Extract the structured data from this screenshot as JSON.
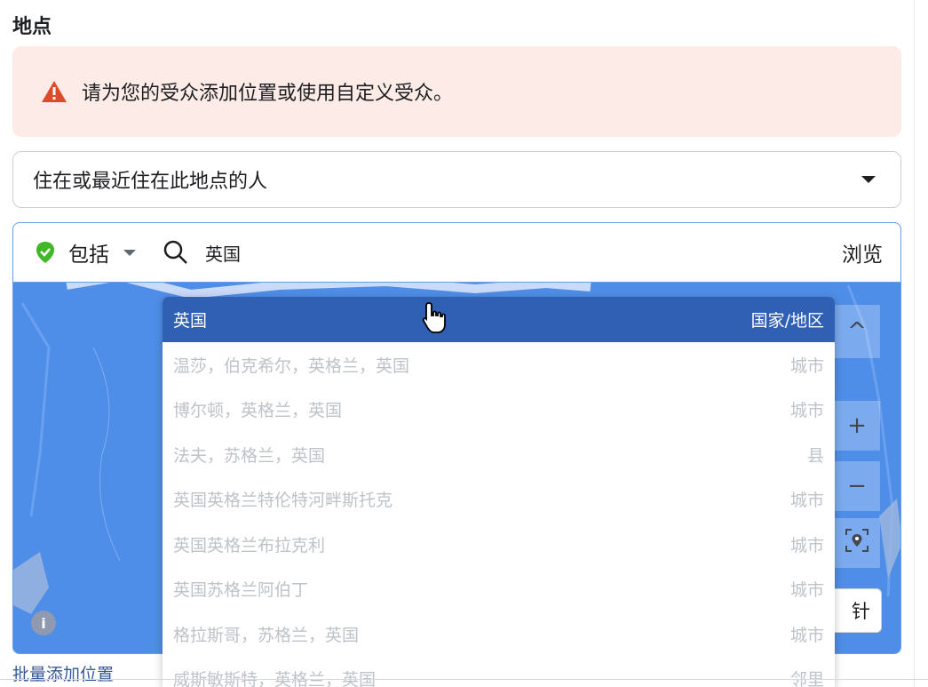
{
  "section_title": "地点",
  "warning": {
    "icon": "warning-triangle-icon",
    "text": "请为您的受众添加位置或使用自定义受众。",
    "color": "#dd4b2a"
  },
  "location_type_select": {
    "value": "住在或最近住在此地点的人"
  },
  "search": {
    "include_label": "包括",
    "query": "英国",
    "browse_label": "浏览",
    "include_color": "#42b72a"
  },
  "map": {
    "pin_button_label": "针",
    "info_icon": "i"
  },
  "suggestions": [
    {
      "name": "英国",
      "type": "国家/地区",
      "highlighted": true
    },
    {
      "name": "温莎，伯克希尔，英格兰，英国",
      "type": "城市"
    },
    {
      "name": "博尔顿，英格兰，英国",
      "type": "城市"
    },
    {
      "name": "法夫，苏格兰，英国",
      "type": "县"
    },
    {
      "name": "英国英格兰特伦特河畔斯托克",
      "type": "城市"
    },
    {
      "name": "英国英格兰布拉克利",
      "type": "城市"
    },
    {
      "name": "英国苏格兰阿伯丁",
      "type": "城市"
    },
    {
      "name": "格拉斯哥，苏格兰，英国",
      "type": "城市"
    },
    {
      "name": "威斯敏斯特，英格兰，英国",
      "type": "邻里"
    }
  ],
  "bulk_add_link": "批量添加位置"
}
